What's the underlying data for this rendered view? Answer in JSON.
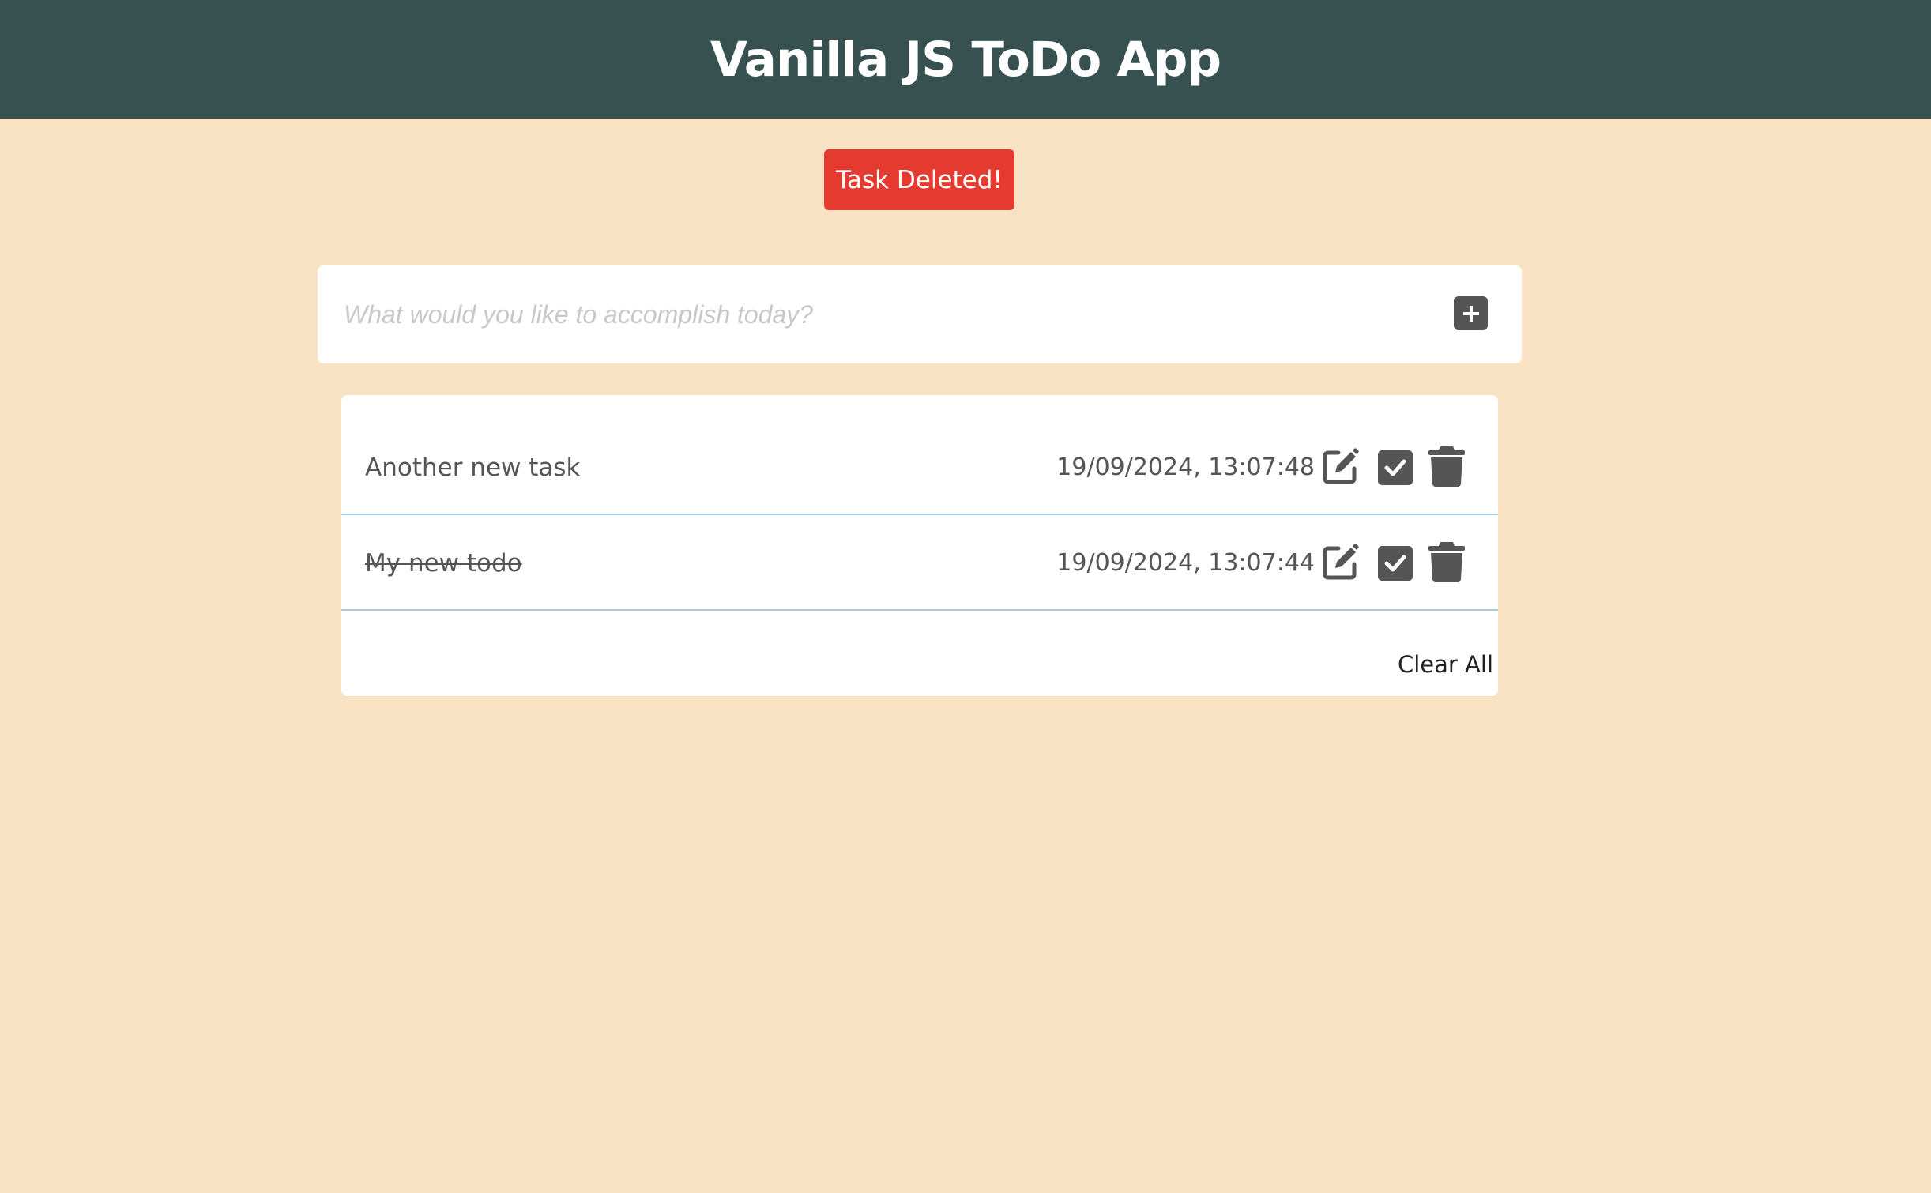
{
  "header": {
    "title": "Vanilla JS ToDo App"
  },
  "toast": {
    "message": "Task Deleted!",
    "color": "#e53a2f"
  },
  "new_task": {
    "placeholder": "What would you like to accomplish today?",
    "value": "",
    "add_icon": "plus-square-icon"
  },
  "tasks": [
    {
      "label": "Another new task",
      "timestamp": "19/09/2024, 13:07:48",
      "completed": false
    },
    {
      "label": "My new todo",
      "timestamp": "19/09/2024, 13:07:44",
      "completed": true
    }
  ],
  "actions": {
    "edit_icon": "edit-icon",
    "complete_icon": "check-square-icon",
    "delete_icon": "trash-icon"
  },
  "footer": {
    "clear_all_label": "Clear All"
  },
  "colors": {
    "header_bg": "#365150",
    "page_bg": "#fae3c5",
    "icon": "#555555",
    "divider": "#a9cbe0"
  }
}
